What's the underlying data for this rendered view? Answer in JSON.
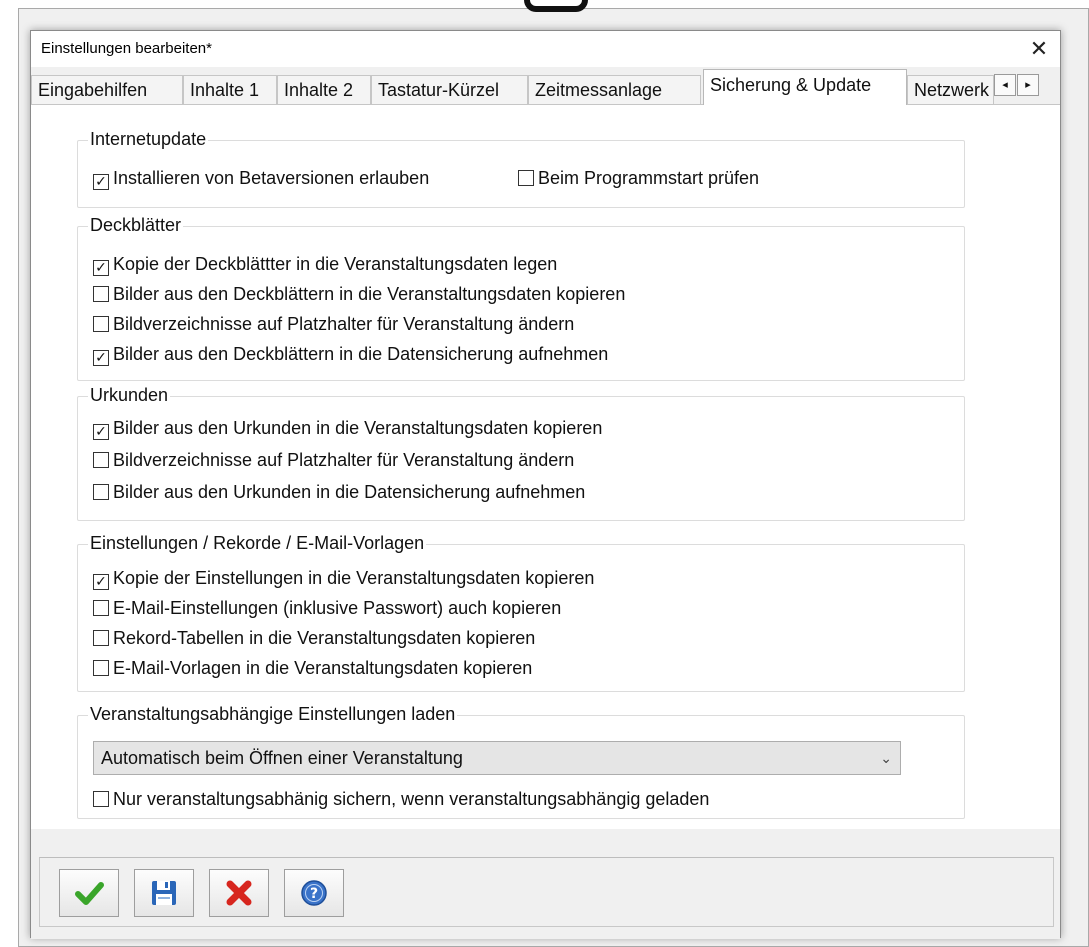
{
  "window": {
    "title": "Einstellungen bearbeiten*",
    "close_symbol": "✕"
  },
  "tabs": [
    {
      "label": "Eingabehilfen"
    },
    {
      "label": "Inhalte 1"
    },
    {
      "label": "Inhalte 2"
    },
    {
      "label": "Tastatur-Kürzel"
    },
    {
      "label": "Zeitmessanlage"
    },
    {
      "label": "Sicherung & Update",
      "active": true
    },
    {
      "label": "Netzwerk"
    }
  ],
  "tab_scroll": {
    "left": "◂",
    "right": "▸"
  },
  "groups": {
    "internetupdate": {
      "title": "Internetupdate",
      "items": [
        {
          "label": "Installieren von Betaversionen erlauben",
          "checked": true
        },
        {
          "label": "Beim Programmstart prüfen",
          "checked": false
        }
      ]
    },
    "deckblaetter": {
      "title": "Deckblätter",
      "items": [
        {
          "label": "Kopie der Deckblättter in die Veranstaltungsdaten legen",
          "checked": true
        },
        {
          "label": "Bilder aus den Deckblättern in die Veranstaltungsdaten kopieren",
          "checked": false
        },
        {
          "label": "Bildverzeichnisse auf Platzhalter für Veranstaltung ändern",
          "checked": false
        },
        {
          "label": "Bilder aus den Deckblättern in die Datensicherung aufnehmen",
          "checked": true
        }
      ]
    },
    "urkunden": {
      "title": "Urkunden",
      "items": [
        {
          "label": "Bilder aus den Urkunden in die Veranstaltungsdaten kopieren",
          "checked": true
        },
        {
          "label": "Bildverzeichnisse auf Platzhalter für Veranstaltung ändern",
          "checked": false
        },
        {
          "label": "Bilder aus den Urkunden in die Datensicherung aufnehmen",
          "checked": false
        }
      ]
    },
    "einstellungen": {
      "title": "Einstellungen / Rekorde / E-Mail-Vorlagen",
      "items": [
        {
          "label": "Kopie der Einstellungen in die Veranstaltungsdaten kopieren",
          "checked": true
        },
        {
          "label": "E-Mail-Einstellungen (inklusive Passwort) auch kopieren",
          "checked": false
        },
        {
          "label": "Rekord-Tabellen in die Veranstaltungsdaten kopieren",
          "checked": false
        },
        {
          "label": "E-Mail-Vorlagen in die Veranstaltungsdaten kopieren",
          "checked": false
        }
      ]
    },
    "laden": {
      "title": "Veranstaltungsabhängige Einstellungen laden",
      "select_value": "Automatisch beim Öffnen einer Veranstaltung",
      "items": [
        {
          "label": "Nur veranstaltungsabhänig sichern, wenn veranstaltungsabhängig geladen",
          "checked": false
        }
      ]
    }
  },
  "checkmark_symbol": "✓",
  "chevron_symbol": "⌄",
  "toolbar_buttons": [
    {
      "icon": "checkmark-icon",
      "color": "#3aa52a"
    },
    {
      "icon": "floppy-disk-icon",
      "color": "#2a66b8"
    },
    {
      "icon": "red-x-icon",
      "color": "#d7261e"
    },
    {
      "icon": "help-icon",
      "color": "#3a73c9"
    }
  ]
}
